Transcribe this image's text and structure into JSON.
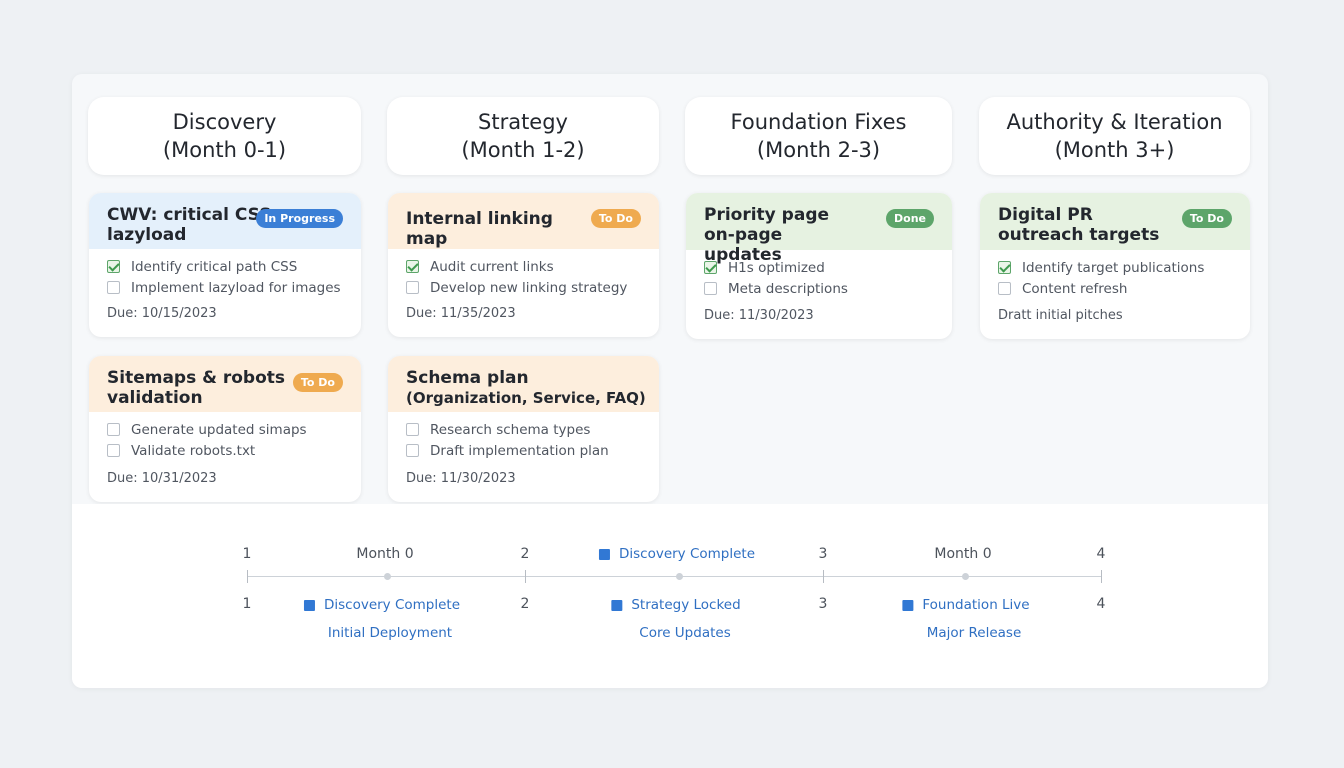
{
  "columns": [
    {
      "title": "Discovery",
      "subtitle": "(Month 0-1)"
    },
    {
      "title": "Strategy",
      "subtitle": "(Month 1-2)"
    },
    {
      "title": "Foundation Fixes",
      "subtitle": "(Month 2-3)"
    },
    {
      "title": "Authority & Iteration",
      "subtitle": "(Month 3+)"
    }
  ],
  "cards": {
    "cwv": {
      "title": "CWV: critical CSS + lazyload",
      "badge": "In Progress",
      "badge_color": "#3b7fd6",
      "tasks": [
        {
          "label": "Identify critical path CSS",
          "checked": true
        },
        {
          "label": "Implement lazyload for images",
          "checked": false
        }
      ],
      "due": "Due: 10/15/2023"
    },
    "sitemaps": {
      "title": "Sitemaps & robots validation",
      "badge": "To Do",
      "badge_color": "#efaa4f",
      "tasks": [
        {
          "label": "Generate updated simaps",
          "checked": false
        },
        {
          "label": "Validate robots.txt",
          "checked": false
        }
      ],
      "due": "Due: 10/31/2023"
    },
    "linking": {
      "title": "Internal linking map",
      "badge": "To Do",
      "badge_color": "#efaa4f",
      "tasks": [
        {
          "label": "Audit current links",
          "checked": true
        },
        {
          "label": "Develop new linking strategy",
          "checked": false
        }
      ],
      "due": "Due: 11/35/2023"
    },
    "schema": {
      "title": "Schema plan",
      "subtitle": "(Organization, Service, FAQ)",
      "tasks": [
        {
          "label": "Research schema types",
          "checked": false
        },
        {
          "label": "Draft implementation plan",
          "checked": false
        }
      ],
      "due": "Due: 11/30/2023"
    },
    "priority": {
      "title": "Priority page on-page updates",
      "badge": "Done",
      "badge_color": "#5da56a",
      "tasks": [
        {
          "label": "H1s optimized",
          "checked": true
        },
        {
          "label": "Meta descriptions",
          "checked": false
        }
      ],
      "due": "Due: 11/30/2023"
    },
    "pr": {
      "title": "Digital PR outreach targets",
      "badge": "To Do",
      "badge_color": "#5da56a",
      "tasks": [
        {
          "label": "Identify target publications",
          "checked": true
        },
        {
          "label": "Content refresh",
          "checked": false
        }
      ],
      "extra": "Dratt initial pitches"
    }
  },
  "timeline": {
    "top_labels": [
      "1",
      "Month 0",
      "2",
      "Discovery Complete",
      "3",
      "Month 0",
      "4"
    ],
    "bottom_numbers": [
      "1",
      "2",
      "3",
      "4"
    ],
    "milestones": [
      "Discovery Complete",
      "Strategy Locked",
      "Foundation Live"
    ],
    "releases": [
      "Initial Deployment",
      "Core Updates",
      "Major Release"
    ]
  }
}
